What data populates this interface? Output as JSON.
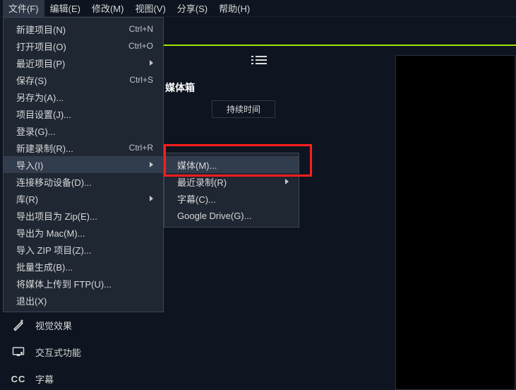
{
  "menubar": {
    "items": [
      {
        "label": "文件(F)"
      },
      {
        "label": "编辑(E)"
      },
      {
        "label": "修改(M)"
      },
      {
        "label": "视图(V)"
      },
      {
        "label": "分享(S)"
      },
      {
        "label": "帮助(H)"
      }
    ]
  },
  "file_menu": [
    {
      "label": "新建项目(N)",
      "accel": "Ctrl+N"
    },
    {
      "label": "打开项目(O)",
      "accel": "Ctrl+O"
    },
    {
      "label": "最近项目(P)",
      "submenu": true
    },
    {
      "label": "保存(S)",
      "accel": "Ctrl+S"
    },
    {
      "label": "另存为(A)..."
    },
    {
      "label": "项目设置(J)..."
    },
    {
      "label": "登录(G)..."
    },
    {
      "label": "新建录制(R)...",
      "accel": "Ctrl+R"
    },
    {
      "label": "导入(I)",
      "submenu": true,
      "hover": true
    },
    {
      "label": "连接移动设备(D)..."
    },
    {
      "label": "库(R)",
      "submenu": true
    },
    {
      "label": "导出项目为 Zip(E)..."
    },
    {
      "label": "导出为 Mac(M)..."
    },
    {
      "label": "导入 ZIP 项目(Z)..."
    },
    {
      "label": "批量生成(B)..."
    },
    {
      "label": "将媒体上传到 FTP(U)..."
    },
    {
      "label": "退出(X)"
    }
  ],
  "import_submenu": [
    {
      "label": "媒体(M)...",
      "hover": true
    },
    {
      "label": "最近录制(R)",
      "submenu": true
    },
    {
      "label": "字幕(C)..."
    },
    {
      "label": "Google Drive(G)..."
    }
  ],
  "mediabox_title": "媒体箱",
  "column_duration": "持续时间",
  "sidebar": {
    "vfx": "视觉效果",
    "interactive": "交互式功能",
    "cc": "字幕",
    "cc_badge": "CC"
  }
}
